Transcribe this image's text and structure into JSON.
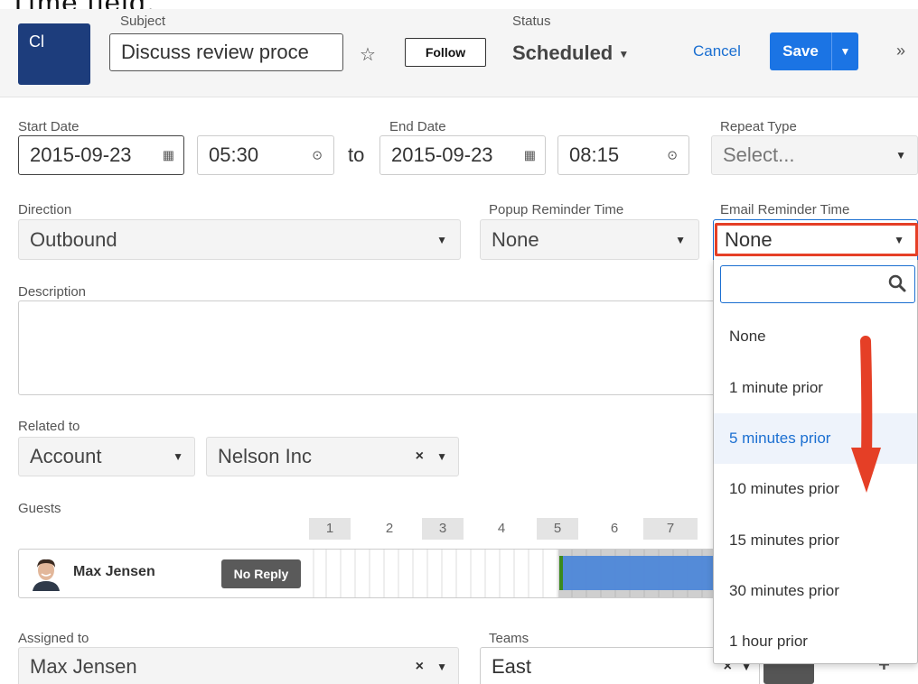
{
  "caption_fragment": "Time field.",
  "header": {
    "avatar_initials": "Cl",
    "subject_label": "Subject",
    "subject_value": "Discuss review proce",
    "follow_label": "Follow",
    "status_label": "Status",
    "status_value": "Scheduled",
    "cancel_label": "Cancel",
    "save_label": "Save"
  },
  "dates": {
    "start_label": "Start Date",
    "start_date": "2015-09-23",
    "start_time": "05:30",
    "to_label": "to",
    "end_label": "End Date",
    "end_date": "2015-09-23",
    "end_time": "08:15",
    "repeat_label": "Repeat Type",
    "repeat_value": "Select..."
  },
  "fields": {
    "direction_label": "Direction",
    "direction_value": "Outbound",
    "popup_label": "Popup Reminder Time",
    "popup_value": "None",
    "email_label": "Email Reminder Time",
    "email_value": "None",
    "description_label": "Description",
    "related_label": "Related to",
    "related_type": "Account",
    "related_value": "Nelson Inc",
    "guests_label": "Guests",
    "assigned_label": "Assigned to",
    "assigned_value": "Max Jensen",
    "teams_label": "Teams",
    "teams_value": "East"
  },
  "timeline": {
    "hours": [
      "1",
      "2",
      "3",
      "4",
      "5",
      "6",
      "7"
    ]
  },
  "guest": {
    "name": "Max Jensen",
    "status": "No Reply"
  },
  "email_dropdown": {
    "options": [
      "None",
      "1 minute prior",
      "5 minutes prior",
      "10 minutes prior",
      "15 minutes prior",
      "30 minutes prior",
      "1 hour prior"
    ],
    "highlighted_index": 2
  },
  "colors": {
    "brand_blue": "#1b74e4",
    "highlight_red": "#e53f26",
    "avatar_navy": "#1d3d7c"
  }
}
